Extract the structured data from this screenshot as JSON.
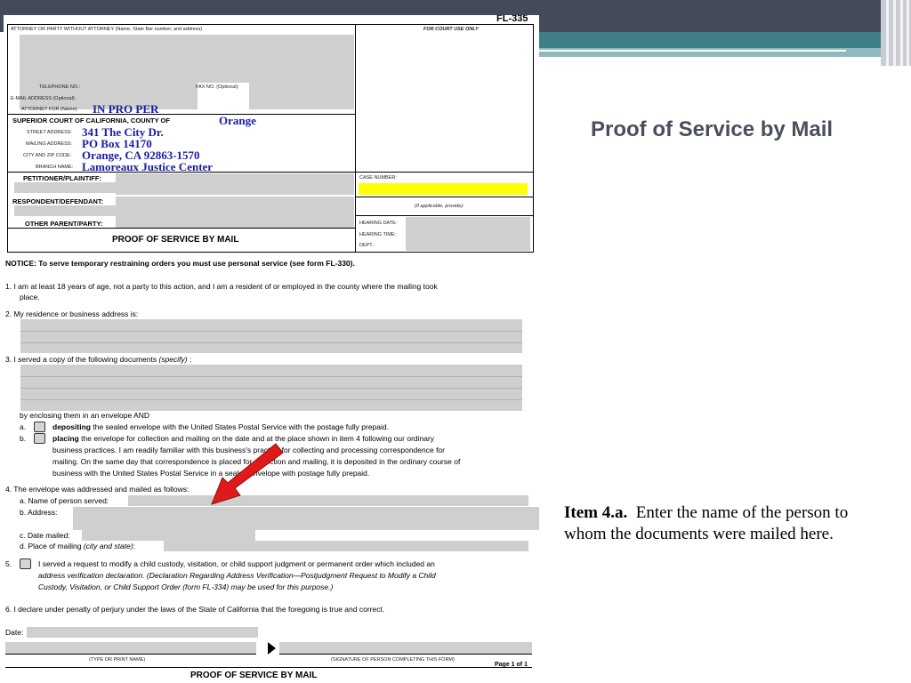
{
  "slide": {
    "title": "Proof of Service by Mail",
    "callout_bold": "Item 4.a.",
    "callout_text": "Enter the name of the person to whom the documents were mailed here."
  },
  "form": {
    "form_number": "FL-335",
    "attorney_header": "ATTORNEY OR PARTY WITHOUT ATTORNEY (Name, State Bar number, and address)",
    "court_use": "FOR COURT USE ONLY",
    "telephone": "TELEPHONE NO.:",
    "fax": "FAX NO. (Optional):",
    "email": "E-MAIL ADDRESS (Optional):",
    "attorney_for": "ATTORNEY FOR (Name):",
    "attorney_for_value": "IN PRO PER",
    "court": "SUPERIOR COURT OF CALIFORNIA, COUNTY OF",
    "county_value": "Orange",
    "street_label": "STREET ADDRESS:",
    "street_value": "341 The City Dr.",
    "mailing_label": "MAILING ADDRESS:",
    "mailing_value": "PO Box 14170",
    "city_label": "CITY AND ZIP CODE:",
    "city_value": "Orange, CA  92863-1570",
    "branch_label": "BRANCH NAME:",
    "branch_value": "Lamoreaux Justice Center",
    "petitioner": "PETITIONER/PLAINTIFF:",
    "respondent": "RESPONDENT/DEFENDANT:",
    "other_parent": "OTHER PARENT/PARTY:",
    "doc_title": "PROOF OF SERVICE BY MAIL",
    "case_number": "CASE NUMBER:",
    "if_applicable": "(If applicable, provide):",
    "hearing_date": "HEARING DATE:",
    "hearing_time": "HEARING TIME:",
    "dept": "DEPT.:",
    "notice": "NOTICE: To serve temporary restraining orders you must use personal service (see form FL-330).",
    "item1_a": "1.   I am at least 18 years of age, not a party to this action, and I am a resident of or employed in the county where the mailing took",
    "item1_b": "place.",
    "item2": "2.   My residence or business address is:",
    "item3_prefix": "3.   I served a copy of the following documents",
    "item3_specify": "(specify)",
    "item3_suffix": ":",
    "enclosing": "by enclosing them in an envelope AND",
    "opt_a_letter": "a.",
    "opt_a_bold": "depositing",
    "opt_a_rest": "the sealed envelope with the United States Postal Service with the postage fully prepaid.",
    "opt_b_letter": "b.",
    "opt_b_bold": "placing",
    "opt_b_rest": "the envelope for collection and mailing on the date and at the place shown in item 4 following our ordinary",
    "opt_b_l2": "business practices. I am readily familiar with this business's practice for collecting and processing correspondence for",
    "opt_b_l3": "mailing. On the same day that correspondence is placed for collection and mailing, it is deposited in the ordinary course of",
    "opt_b_l4": "business with the United States Postal Service in a sealed envelope with postage fully prepaid.",
    "item4": "4.   The envelope was addressed and mailed as follows:",
    "item4a": "a.   Name of person served:",
    "item4b": "b.   Address:",
    "item4c": "c.   Date mailed:",
    "item4d_prefix": "d.   Place of mailing",
    "item4d_italic": "(city and state)",
    "item4d_suffix": ":",
    "item5_num": "5.",
    "item5_l1": "I served a request to modify a child custody, visitation, or child support judgment or permanent order which included an",
    "item5_l2": "address verification declaration. (Declaration Regarding Address Verification—Postjudgment Request to Modify a Child",
    "item5_l3": "Custody, Visitation, or Child Support Order (form FL-334) may be used for this purpose.)",
    "item6": "6.   I declare under penalty of perjury under the laws of the State of California that the foregoing is true and correct.",
    "date_label": "Date:",
    "type_name": "(TYPE OR PRINT NAME)",
    "signature": "(SIGNATURE OF PERSON COMPLETING THIS FORM)",
    "page": "Page 1 of 1",
    "footer_title": "PROOF OF SERVICE BY MAIL"
  },
  "colors": {
    "handwriting": "#1a1aa6",
    "arrow": "#e01a1a",
    "highlight": "#ffff00",
    "redaction": "#cfcfcf"
  }
}
